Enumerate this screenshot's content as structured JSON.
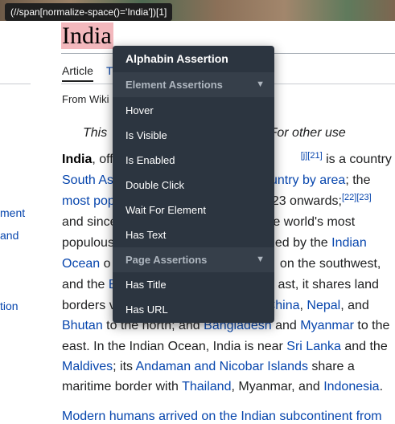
{
  "xpath_badge": "(//span[normalize-space()='India'])[1]",
  "page": {
    "title": "India",
    "tabs": {
      "article": "Article",
      "talk": "T"
    },
    "from": "From Wiki",
    "hatnote": {
      "left": "This",
      "right": "of India. For other use"
    }
  },
  "sidebar": {
    "items": [
      "ment",
      "and",
      "tion"
    ]
  },
  "paragraph": {
    "l1": {
      "bold": "India",
      "t1": ", off",
      "sup": "[j][21]",
      "t2": " is a country in"
    },
    "l2": {
      "a1": "South As",
      "a2": "ountry by area",
      "t1": "; the"
    },
    "l3": {
      "a1": "most pop",
      "t1": "23 onwards;",
      "sup": "[22][23]"
    },
    "l4": {
      "t1": "and since",
      "t2": "he world's most"
    },
    "l5": {
      "t1": "populous",
      "t2": "ded by the ",
      "a1": "Indian"
    },
    "l6": {
      "a1": "Ocean",
      "t1": " o",
      "t2": " on the southwest,"
    },
    "l7": {
      "t1": "and the ",
      "a1": "B",
      "t2": "ast, it shares land"
    },
    "l8": {
      "t1": "borders v",
      "a1": "China",
      "t2": ", ",
      "a2": "Nepal",
      "t3": ", and"
    },
    "l9": {
      "a1": "Bhutan",
      "t1": " to the north; and ",
      "a2": "Bangladesh",
      "t2": " and ",
      "a3": "Myanmar",
      "t3": " to the"
    },
    "l10": {
      "t1": "east. In the Indian Ocean, India is near ",
      "a1": "Sri Lanka",
      "t2": " and the"
    },
    "l11": {
      "a1": "Maldives",
      "t1": "; its ",
      "a2": "Andaman and Nicobar Islands",
      "t2": " share a"
    },
    "l12": {
      "t1": "maritime border with ",
      "a1": "Thailand",
      "t2": ", Myanmar, and ",
      "a2": "Indonesia",
      "t3": "."
    },
    "cut": "Modern humans arrived on the Indian subcontinent from"
  },
  "menu": {
    "title": "Alphabin Assertion",
    "sections": [
      {
        "label": "Element Assertions",
        "items": [
          "Hover",
          "Is Visible",
          "Is Enabled",
          "Double Click",
          "Wait For Element",
          "Has Text"
        ]
      },
      {
        "label": "Page Assertions",
        "items": [
          "Has Title",
          "Has URL"
        ]
      }
    ],
    "caret": "▼"
  },
  "colors": {
    "link": "#0645ad",
    "menu_bg": "#2c3540",
    "section_bg": "#363f4a",
    "highlight": "#f3b8bd"
  }
}
